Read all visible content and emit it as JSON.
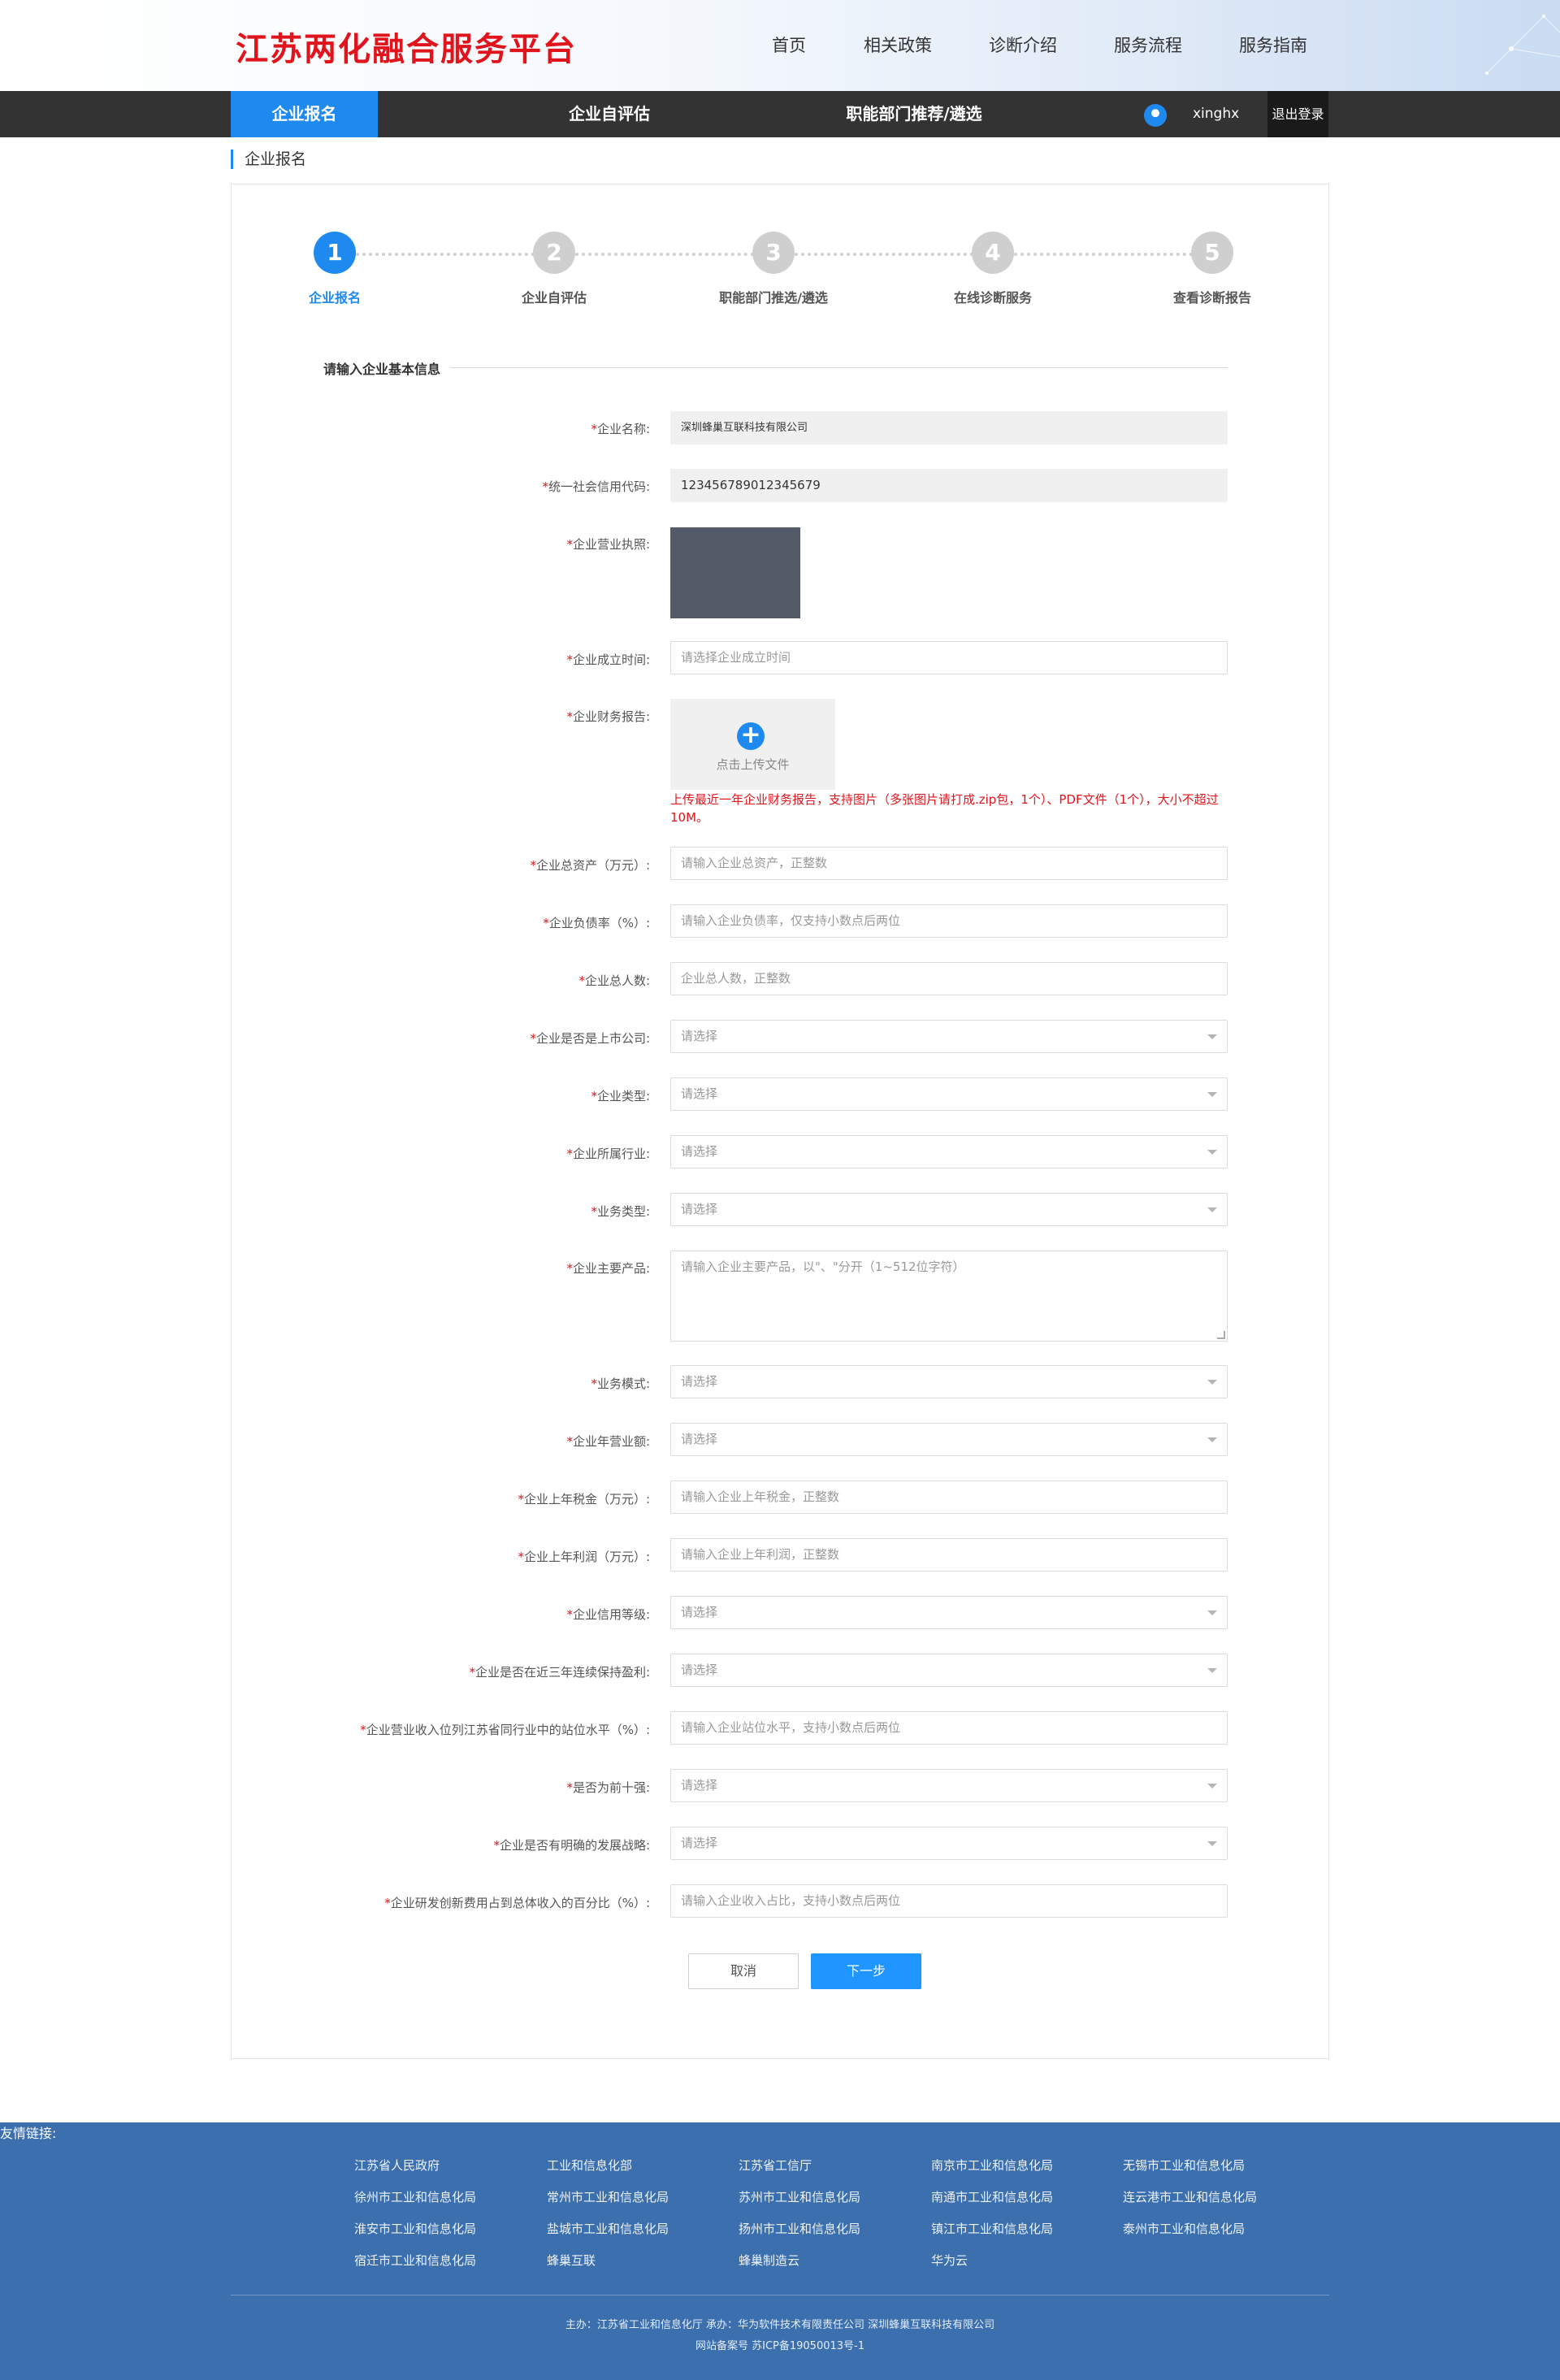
{
  "header": {
    "logo": "江苏两化融合服务平台",
    "nav": [
      "首页",
      "相关政策",
      "诊断介绍",
      "服务流程",
      "服务指南"
    ]
  },
  "navbar": {
    "tabs": [
      "企业报名",
      "企业自评估",
      "职能部门推荐/遴选"
    ],
    "username": "xinghx",
    "logout": "退出登录"
  },
  "breadcrumb": "企业报名",
  "steps": [
    {
      "num": "1",
      "label": "企业报名"
    },
    {
      "num": "2",
      "label": "企业自评估"
    },
    {
      "num": "3",
      "label": "职能部门推选/遴选"
    },
    {
      "num": "4",
      "label": "在线诊断服务"
    },
    {
      "num": "5",
      "label": "查看诊断报告"
    }
  ],
  "section_title": "请输入企业基本信息",
  "form": {
    "company_name": {
      "label": "企业名称:",
      "value": "深圳蜂巢互联科技有限公司"
    },
    "credit_code": {
      "label": "统一社会信用代码:",
      "value": "123456789012345679"
    },
    "license": {
      "label": "企业营业执照:"
    },
    "founded": {
      "label": "企业成立时间:",
      "placeholder": "请选择企业成立时间"
    },
    "finance_report": {
      "label": "企业财务报告:",
      "upload_text": "点击上传文件",
      "hint": "上传最近一年企业财务报告，支持图片（多张图片请打成.zip包，1个）、PDF文件（1个），大小不超过10M。"
    },
    "total_assets": {
      "label": "企业总资产（万元）:",
      "placeholder": "请输入企业总资产，正整数"
    },
    "debt_ratio": {
      "label": "企业负债率（%）:",
      "placeholder": "请输入企业负债率，仅支持小数点后两位"
    },
    "employees": {
      "label": "企业总人数:",
      "placeholder": "企业总人数，正整数"
    },
    "listed": {
      "label": "企业是否是上市公司:",
      "placeholder": "请选择"
    },
    "company_type": {
      "label": "企业类型:",
      "placeholder": "请选择"
    },
    "industry": {
      "label": "企业所属行业:",
      "placeholder": "请选择"
    },
    "business_type": {
      "label": "业务类型:",
      "placeholder": "请选择"
    },
    "products": {
      "label": "企业主要产品:",
      "placeholder": "请输入企业主要产品，以\"、\"分开（1~512位字符）"
    },
    "business_mode": {
      "label": "业务模式:",
      "placeholder": "请选择"
    },
    "annual_revenue": {
      "label": "企业年营业额:",
      "placeholder": "请选择"
    },
    "last_tax": {
      "label": "企业上年税金（万元）:",
      "placeholder": "请输入企业上年税金，正整数"
    },
    "last_profit": {
      "label": "企业上年利润（万元）:",
      "placeholder": "请输入企业上年利润，正整数"
    },
    "credit_level": {
      "label": "企业信用等级:",
      "placeholder": "请选择"
    },
    "profitable": {
      "label": "企业是否在近三年连续保持盈利:",
      "placeholder": "请选择"
    },
    "revenue_rank": {
      "label": "企业营业收入位列江苏省同行业中的站位水平（%）:",
      "placeholder": "请输入企业站位水平，支持小数点后两位"
    },
    "top_ten": {
      "label": "是否为前十强:",
      "placeholder": "请选择"
    },
    "strategy": {
      "label": "企业是否有明确的发展战略:",
      "placeholder": "请选择"
    },
    "rd_ratio": {
      "label": "企业研发创新费用占到总体收入的百分比（%）:",
      "placeholder": "请输入企业收入占比，支持小数点后两位"
    }
  },
  "buttons": {
    "cancel": "取消",
    "next": "下一步"
  },
  "footer": {
    "title": "友情链接:",
    "links": [
      [
        "江苏省人民政府",
        "工业和信息化部",
        "江苏省工信厅",
        "南京市工业和信息化局",
        "无锡市工业和信息化局"
      ],
      [
        "徐州市工业和信息化局",
        "常州市工业和信息化局",
        "苏州市工业和信息化局",
        "南通市工业和信息化局",
        "连云港市工业和信息化局"
      ],
      [
        "淮安市工业和信息化局",
        "盐城市工业和信息化局",
        "扬州市工业和信息化局",
        "镇江市工业和信息化局",
        "泰州市工业和信息化局"
      ],
      [
        "宿迁市工业和信息化局",
        "蜂巢互联",
        "蜂巢制造云",
        "华为云",
        ""
      ]
    ],
    "info1": "主办：江苏省工业和信息化厅   承办：华为软件技术有限责任公司   深圳蜂巢互联科技有限公司",
    "info2": "网站备案号   苏ICP备19050013号-1"
  },
  "colors": {
    "brand_red": "#e0141c",
    "accent_blue": "#1e8af0",
    "footer_blue": "#3b6fae"
  }
}
